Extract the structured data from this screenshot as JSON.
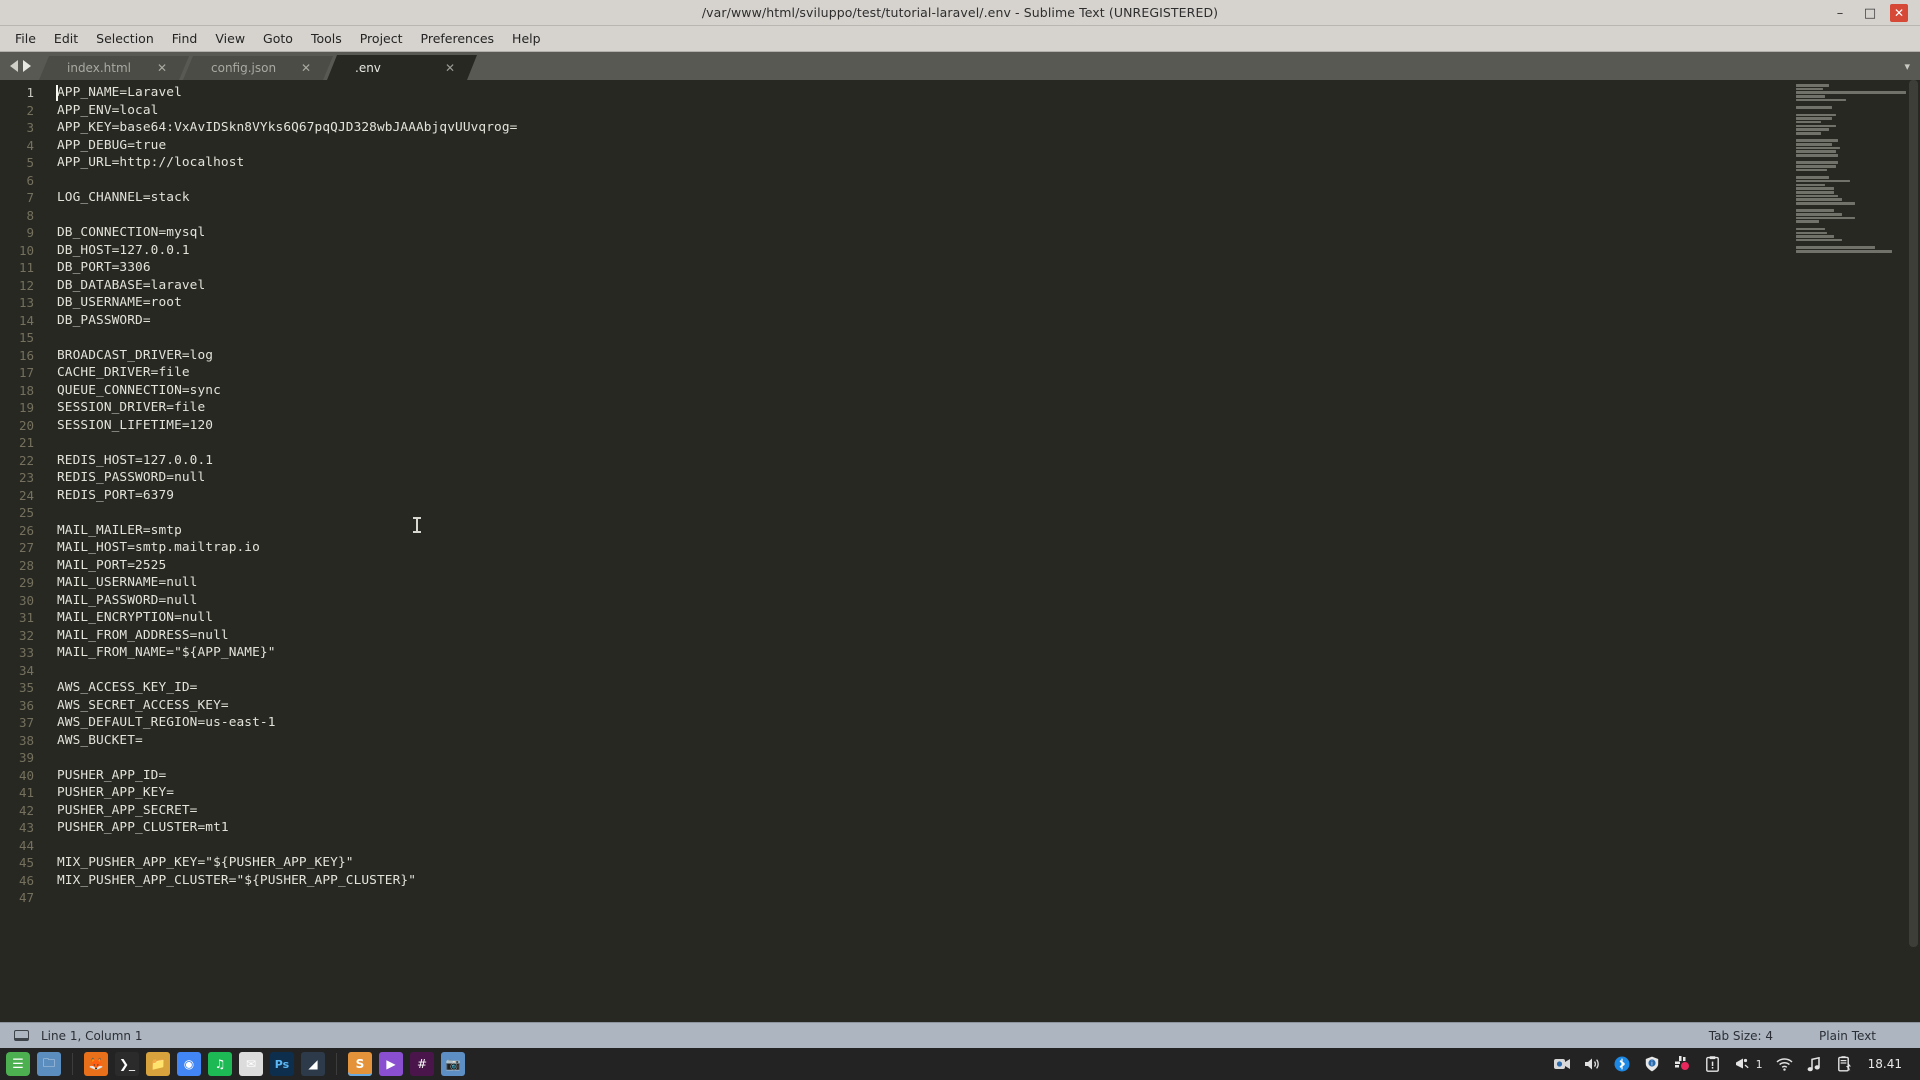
{
  "window": {
    "title": "/var/www/html/sviluppo/test/tutorial-laravel/.env - Sublime Text (UNREGISTERED)",
    "minimize_label": "–",
    "maximize_label": "□",
    "close_label": "✕"
  },
  "menubar": {
    "items": [
      {
        "label": "File"
      },
      {
        "label": "Edit"
      },
      {
        "label": "Selection"
      },
      {
        "label": "Find"
      },
      {
        "label": "View"
      },
      {
        "label": "Goto"
      },
      {
        "label": "Tools"
      },
      {
        "label": "Project"
      },
      {
        "label": "Preferences"
      },
      {
        "label": "Help"
      }
    ]
  },
  "tabs": {
    "items": [
      {
        "label": "index.html",
        "close": "✕",
        "active": false
      },
      {
        "label": "config.json",
        "close": "✕",
        "active": false
      },
      {
        "label": ".env",
        "close": "✕",
        "active": true
      }
    ],
    "overflow_label": "▾"
  },
  "editor": {
    "lines": [
      "APP_NAME=Laravel",
      "APP_ENV=local",
      "APP_KEY=base64:VxAvIDSkn8VYks6Q67pqQJD328wbJAAAbjqvUUvqrog=",
      "APP_DEBUG=true",
      "APP_URL=http://localhost",
      "",
      "LOG_CHANNEL=stack",
      "",
      "DB_CONNECTION=mysql",
      "DB_HOST=127.0.0.1",
      "DB_PORT=3306",
      "DB_DATABASE=laravel",
      "DB_USERNAME=root",
      "DB_PASSWORD=",
      "",
      "BROADCAST_DRIVER=log",
      "CACHE_DRIVER=file",
      "QUEUE_CONNECTION=sync",
      "SESSION_DRIVER=file",
      "SESSION_LIFETIME=120",
      "",
      "REDIS_HOST=127.0.0.1",
      "REDIS_PASSWORD=null",
      "REDIS_PORT=6379",
      "",
      "MAIL_MAILER=smtp",
      "MAIL_HOST=smtp.mailtrap.io",
      "MAIL_PORT=2525",
      "MAIL_USERNAME=null",
      "MAIL_PASSWORD=null",
      "MAIL_ENCRYPTION=null",
      "MAIL_FROM_ADDRESS=null",
      "MAIL_FROM_NAME=\"${APP_NAME}\"",
      "",
      "AWS_ACCESS_KEY_ID=",
      "AWS_SECRET_ACCESS_KEY=",
      "AWS_DEFAULT_REGION=us-east-1",
      "AWS_BUCKET=",
      "",
      "PUSHER_APP_ID=",
      "PUSHER_APP_KEY=",
      "PUSHER_APP_SECRET=",
      "PUSHER_APP_CLUSTER=mt1",
      "",
      "MIX_PUSHER_APP_KEY=\"${PUSHER_APP_KEY}\"",
      "MIX_PUSHER_APP_CLUSTER=\"${PUSHER_APP_CLUSTER}\"",
      ""
    ],
    "total_lines": 47,
    "current_line": 1
  },
  "statusbar": {
    "position": "Line 1, Column 1",
    "tab_size": "Tab Size: 4",
    "syntax": "Plain Text"
  },
  "taskbar": {
    "apps": [
      {
        "name": "start-menu",
        "glyph": "☰",
        "color": "#4caf50",
        "active": false
      },
      {
        "name": "files-manager",
        "glyph": "🗀",
        "color": "#5b8dbe",
        "active": false
      },
      {
        "name": "firefox",
        "glyph": "🦊",
        "color": "#e8701a",
        "active": false
      },
      {
        "name": "terminal",
        "glyph": "❯_",
        "color": "#2b2b2b",
        "active": false
      },
      {
        "name": "file-explorer",
        "glyph": "📁",
        "color": "#d8a33d",
        "active": false
      },
      {
        "name": "chrome",
        "glyph": "◉",
        "color": "#4285f4",
        "active": false
      },
      {
        "name": "spotify",
        "glyph": "♫",
        "color": "#1db954",
        "active": false
      },
      {
        "name": "mail",
        "glyph": "✉",
        "color": "#dcdcdc",
        "active": false
      },
      {
        "name": "photoshop",
        "glyph": "Ps",
        "color": "#0d2e4d",
        "active": false
      },
      {
        "name": "vector-editor",
        "glyph": "◢",
        "color": "#2d3a4a",
        "active": false
      },
      {
        "name": "sublime-text",
        "glyph": "S",
        "color": "#e4933a",
        "active": true
      },
      {
        "name": "media-player",
        "glyph": "▶",
        "color": "#8a4fd0",
        "active": false
      },
      {
        "name": "slack",
        "glyph": "#",
        "color": "#4a154b",
        "active": false
      },
      {
        "name": "screenshot-tool",
        "glyph": "📷",
        "color": "#5d8fc4",
        "active": false
      }
    ],
    "tray": [
      {
        "name": "screen-record-icon",
        "glyph": "●"
      },
      {
        "name": "volume-icon",
        "glyph": "🔊"
      },
      {
        "name": "bluetooth-icon",
        "glyph": "ᛗ"
      },
      {
        "name": "shield-icon",
        "glyph": "ⓘ"
      },
      {
        "name": "network-manager-icon",
        "glyph": "⚙"
      },
      {
        "name": "clipboard-icon",
        "glyph": "📋"
      },
      {
        "name": "notification-icon",
        "glyph": "🔔"
      },
      {
        "name": "wifi-icon",
        "glyph": "◠"
      },
      {
        "name": "music-note-icon",
        "glyph": "♫"
      },
      {
        "name": "battery-icon",
        "glyph": "⚡"
      }
    ],
    "notification_count": "1",
    "clock": "18.41"
  }
}
